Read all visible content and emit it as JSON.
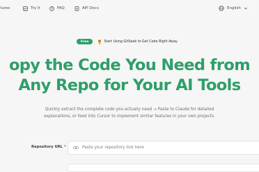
{
  "nav": {
    "items": [
      {
        "label": "atures",
        "icon": "clipped-icon"
      },
      {
        "label": "Try It",
        "icon": "grid-icon"
      },
      {
        "label": "FAQ",
        "icon": "help-circle-icon"
      },
      {
        "label": "API Docs",
        "icon": "document-icon"
      }
    ],
    "language": {
      "label": "English",
      "icon": "globe-icon"
    }
  },
  "promo": {
    "badge": "Free",
    "icon": "trophy-icon",
    "text": "Start Using GitSeek to Get Code Right Away",
    "accent": "#2f9e6a",
    "icon_color": "#e07a1f"
  },
  "hero": {
    "line1": "opy the Code You Need from",
    "line2": "Any Repo for Your AI Tools"
  },
  "subtitle": {
    "line1": "Quickly extract the complete code you actually need → Paste to Claude for detailed",
    "line2": "explanations, or feed into Cursor to implement similar features in your own projects."
  },
  "form": {
    "repo_label": "Repository URL",
    "required_mark": "*",
    "repo_placeholder": "Paste your repository link here",
    "repo_icon": "link-icon"
  }
}
